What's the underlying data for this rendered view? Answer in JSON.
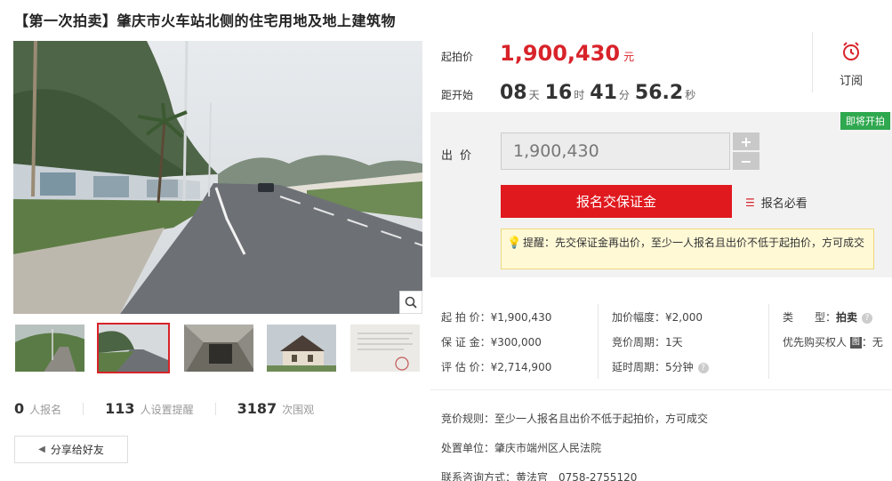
{
  "title": "【第一次拍卖】肇庆市火车站北侧的住宅用地及地上建筑物",
  "stats": [
    {
      "num": "0",
      "unit": "人报名"
    },
    {
      "num": "113",
      "unit": "人设置提醒"
    },
    {
      "num": "3187",
      "unit": "次围观"
    }
  ],
  "share_label": "分享给好友",
  "price": {
    "label": "起拍价",
    "value": "1,900,430",
    "unit": "元"
  },
  "countdown": {
    "label": "距开始",
    "days": "08",
    "days_unit": "天",
    "hours": "16",
    "hours_unit": "时",
    "minutes": "41",
    "minutes_unit": "分",
    "seconds": "56.2",
    "seconds_unit": "秒"
  },
  "subscribe_label": "订阅",
  "badge": "即将开拍",
  "bid": {
    "label": "出价",
    "value": "1,900,430",
    "plus": "+",
    "minus": "−",
    "signup_button": "报名交保证金",
    "must_read": "报名必看",
    "tip": "提醒：先交保证金再出价，至少一人报名且出价不低于起拍价，方可成交"
  },
  "info": {
    "col1": [
      "起 拍 价：¥1,900,430",
      "保 证 金：¥300,000",
      "评 估 价：¥2,714,900"
    ],
    "col2": [
      "加价幅度：¥2,000",
      "竞价周期：1天",
      "延时周期：5分钟"
    ],
    "type_label": "类　　型：",
    "type_value": "拍卖",
    "priority_label": "优先购买权人",
    "priority_tag": "图",
    "priority_value": "：无"
  },
  "rules": {
    "rule_label": "竞价规则：",
    "rule_value": "至少一人报名且出价不低于起拍价，方可成交",
    "court_label": "处置单位：",
    "court_value": "肇庆市端州区人民法院",
    "contact_label": "联系咨询方式：",
    "contact_name": "黄法官",
    "contact_phone": "0758-2755120"
  },
  "colors": {
    "accent": "#d8232a",
    "button": "#e0191f",
    "badge": "#2fa84f",
    "tip_bg": "#fff9d6"
  }
}
